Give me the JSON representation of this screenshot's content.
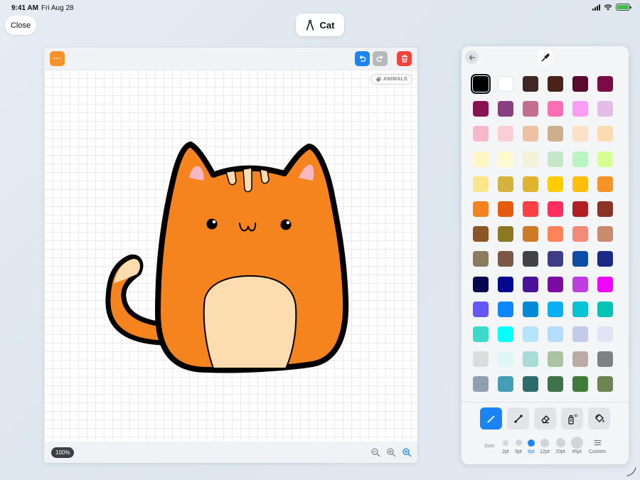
{
  "status_bar": {
    "time": "9:41 AM",
    "date": "Fri Aug 28"
  },
  "header": {
    "close_label": "Close",
    "title": "Cat"
  },
  "canvas": {
    "tag_label": "ANIMALS",
    "zoom_label": "100%",
    "toolbar": {
      "more_label": "···"
    }
  },
  "palette": {
    "selected_index": 0,
    "colors": [
      "#000000",
      "#ffffff",
      "#3f2724",
      "#4a2318",
      "#5a0a2e",
      "#7a0b44",
      "#8b1252",
      "#8b3d82",
      "#c46f8d",
      "#f86fb4",
      "#f99df5",
      "#e3bde8",
      "#f7b8c9",
      "#fbcfd4",
      "#eec0a4",
      "#cdb08b",
      "#fde0c8",
      "#fddbaf",
      "#fff6c2",
      "#fff9d0",
      "#f3f1d8",
      "#c5e6c8",
      "#b9f5c0",
      "#d8ff93",
      "#fbe68d",
      "#d5b13e",
      "#dfb22f",
      "#ffcc00",
      "#ffbe0b",
      "#f8932a",
      "#f38220",
      "#e55c0f",
      "#fd3f46",
      "#ff2e5f",
      "#b31e22",
      "#8d3226",
      "#8d5526",
      "#8c7723",
      "#cd7b29",
      "#ff8359",
      "#f58a78",
      "#c98b6d",
      "#8c7c5f",
      "#7a5747",
      "#434343",
      "#3e3c85",
      "#0e4da7",
      "#1a2a85",
      "#05064e",
      "#05078f",
      "#4a1299",
      "#7b0ba0",
      "#c03ddf",
      "#f004fd",
      "#6657f9",
      "#0f87fc",
      "#0389d6",
      "#0aaff3",
      "#06c4d6",
      "#07c3b7",
      "#3edac9",
      "#08ffff",
      "#b4e3fa",
      "#b3dcfd",
      "#c4caeb",
      "#e3e3f8",
      "#dcdcdc",
      "#dcf7f6",
      "#aadbd7",
      "#aac3a3",
      "#bbaba6",
      "#808080",
      "#8e9fb2",
      "#449db7",
      "#2f6a6d",
      "#3e7349",
      "#3e7c3c",
      "#6b8553"
    ]
  },
  "tools": {
    "active": "pencil",
    "items": [
      {
        "id": "pencil",
        "icon": "pencil-icon"
      },
      {
        "id": "line",
        "icon": "line-tool-icon"
      },
      {
        "id": "eraser",
        "icon": "eraser-icon"
      },
      {
        "id": "spray",
        "icon": "spray-can-icon"
      },
      {
        "id": "fill",
        "icon": "paint-bucket-icon"
      }
    ]
  },
  "brush_size": {
    "label": "Size:",
    "selected": "8pt",
    "options": [
      "2pt",
      "5pt",
      "8pt",
      "12pt",
      "20pt",
      "45pt",
      "Custom"
    ]
  },
  "colors": {
    "accent": "#1a84f3",
    "cat_body": "#f5831e",
    "cat_belly": "#fddcb0",
    "cat_ear_inner": "#f7b8c3",
    "outline": "#000000",
    "more_button": "#f7912a",
    "trash_button": "#f4433c"
  }
}
